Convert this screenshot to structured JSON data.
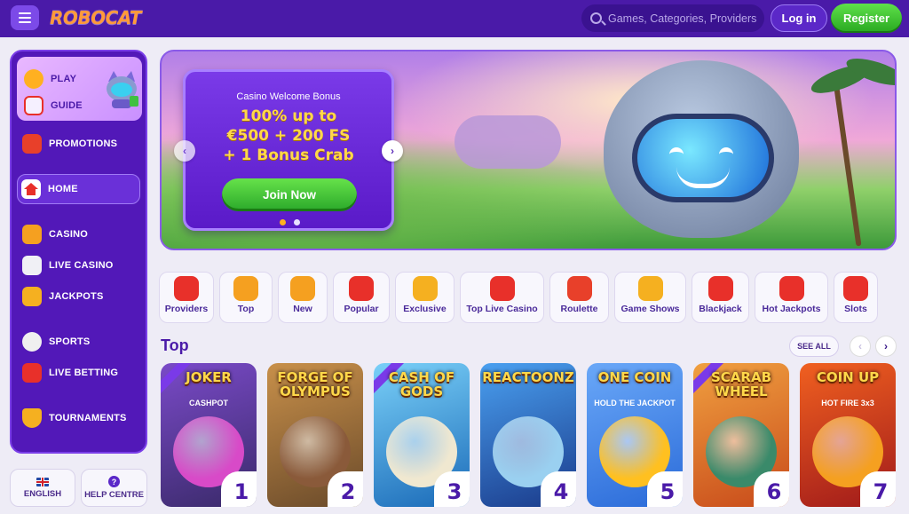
{
  "header": {
    "logo": "ROBOCAT",
    "search_placeholder": "Games, Categories, Providers",
    "login_label": "Log in",
    "register_label": "Register"
  },
  "sidebar": {
    "play_label": "PLAY",
    "guide_label": "GUIDE",
    "promotions_label": "PROMOTIONS",
    "home_label": "HOME",
    "casino_label": "CASINO",
    "live_casino_label": "LIVE CASINO",
    "jackpots_label": "JACKPOTS",
    "sports_label": "SPORTS",
    "live_betting_label": "LIVE BETTING",
    "tournaments_label": "TOURNAMENTS"
  },
  "bottom": {
    "language_label": "ENGLISH",
    "help_label": "HELP CENTRE"
  },
  "hero": {
    "bonus_label": "Casino Welcome Bonus",
    "line1": "100% up to",
    "line2": "€500 + 200 FS",
    "line3": "+ 1 Bonus Crab",
    "join_label": "Join Now",
    "active_slide": 1,
    "slide_count": 2
  },
  "categories": [
    {
      "label": "Providers",
      "icon": "cards-icon",
      "color": "#e8302a",
      "w": 62
    },
    {
      "label": "Top",
      "icon": "medal-icon",
      "color": "#f5a020",
      "w": 60
    },
    {
      "label": "New",
      "icon": "bell-icon",
      "color": "#f5a020",
      "w": 56
    },
    {
      "label": "Popular",
      "icon": "star-icon",
      "color": "#e8302a",
      "w": 64
    },
    {
      "label": "Exclusive",
      "icon": "coin-icon",
      "color": "#f5b020",
      "w": 67
    },
    {
      "label": "Top Live Casino",
      "icon": "chip-icon",
      "color": "#e8302a",
      "w": 95
    },
    {
      "label": "Roulette",
      "icon": "roulette-icon",
      "color": "#e8402a",
      "w": 67
    },
    {
      "label": "Game Shows",
      "icon": "slot-icon",
      "color": "#f5b020",
      "w": 81
    },
    {
      "label": "Blackjack",
      "icon": "blackjack-icon",
      "color": "#e8302a",
      "w": 65
    },
    {
      "label": "Hot Jackpots",
      "icon": "seven-icon",
      "color": "#e8302a",
      "w": 83
    },
    {
      "label": "Slots",
      "icon": "slots-icon",
      "color": "#e8302a",
      "w": 50
    }
  ],
  "top_section": {
    "title": "Top",
    "see_all_label": "SEE ALL"
  },
  "games": [
    {
      "title": "JOKER",
      "sub": "CASHPOT",
      "rank": "1",
      "bg": "#3a2a6a",
      "bg2": "#7a4ac8",
      "art": "#d84ac8",
      "exclusive": true
    },
    {
      "title": "FORGE OF OLYMPUS",
      "sub": "",
      "rank": "2",
      "bg": "#6a4a2a",
      "bg2": "#c8904a",
      "art": "#8a5a3a",
      "exclusive": false
    },
    {
      "title": "CASH OF GODS",
      "sub": "",
      "rank": "3",
      "bg": "#1a6ab8",
      "bg2": "#7ad0f8",
      "art": "#f0e8d0",
      "exclusive": true
    },
    {
      "title": "REACTOONZ",
      "sub": "",
      "rank": "4",
      "bg": "#1a3a8a",
      "bg2": "#4aa0f0",
      "art": "#9ad0f0",
      "exclusive": false
    },
    {
      "title": "ONE COIN",
      "sub": "HOLD THE JACKPOT",
      "rank": "5",
      "bg": "#2a6ad8",
      "bg2": "#6aa8f8",
      "art": "#ffc020",
      "exclusive": false
    },
    {
      "title": "SCARAB WHEEL",
      "sub": "",
      "rank": "6",
      "bg": "#c84a1a",
      "bg2": "#f0a040",
      "art": "#3a8a6a",
      "exclusive": true
    },
    {
      "title": "COIN UP",
      "sub": "HOT FIRE 3x3",
      "rank": "7",
      "bg": "#a01a1a",
      "bg2": "#f06020",
      "art": "#f5a020",
      "exclusive": false
    }
  ]
}
